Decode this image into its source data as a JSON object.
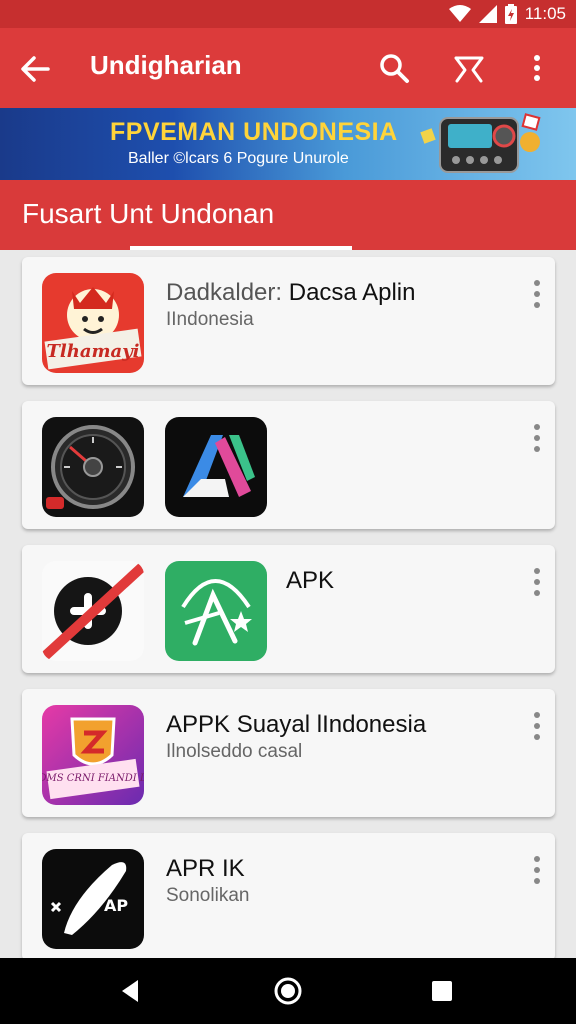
{
  "status_bar": {
    "time": "11:05"
  },
  "app_bar": {
    "title": "Undigharian",
    "back_icon": "arrow-left-icon",
    "actions": [
      "search-icon",
      "filter-icon",
      "more-vert-icon"
    ]
  },
  "banner": {
    "headline": "FPVEMAN UNDONESIA",
    "subline": "Baller ©lcars 6 Pogure Unurole"
  },
  "section": {
    "title": "Fusart Unt Undonan"
  },
  "cards": [
    {
      "title_prefix": "Dadkalder: ",
      "title": "Dacsa Aplin",
      "subtitle": "IIndonesia",
      "icon_text": "Tlhamayi"
    },
    {
      "title": "",
      "subtitle": ""
    },
    {
      "title": "APK",
      "subtitle": ""
    },
    {
      "title": "APPK Suayal lIndonesia",
      "subtitle": "Ilnolseddo casal",
      "icon_text": "CONDMS CRNI FIANDI DONE"
    },
    {
      "title": "APR IK",
      "subtitle": "Sonolikan",
      "icon_text": "AP"
    }
  ],
  "colors": {
    "primary": "#dc3b3b",
    "status": "#c62f2f",
    "banner_text": "#ffd43a"
  },
  "nav_bar": [
    "back-triangle-icon",
    "home-circle-icon",
    "recents-square-icon"
  ]
}
